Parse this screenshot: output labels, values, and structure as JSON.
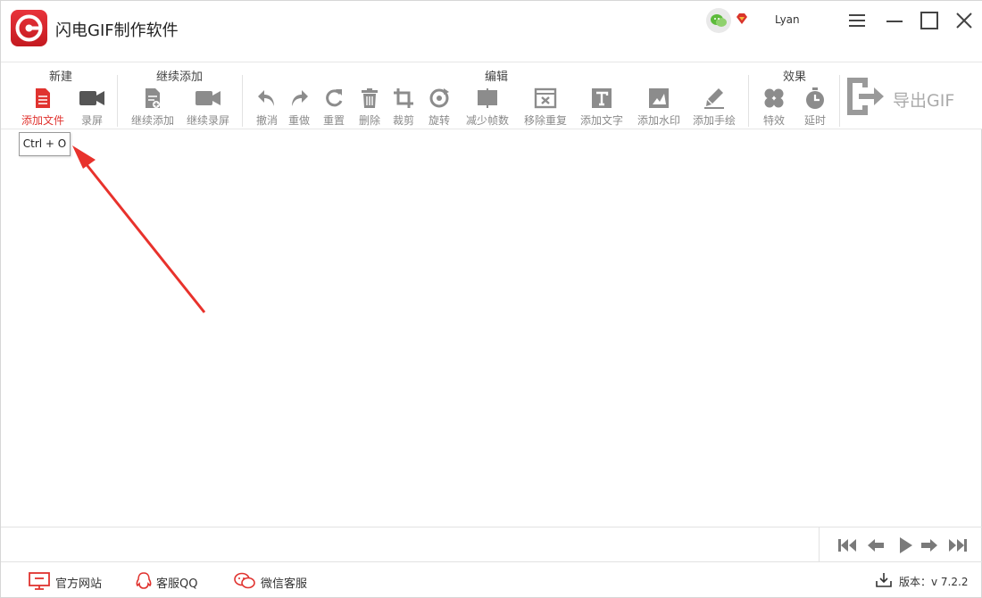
{
  "app": {
    "title": "闪电GIF制作软件"
  },
  "user": {
    "name": "Lyan"
  },
  "toolbar": {
    "groups": [
      {
        "title": "新建"
      },
      {
        "title": "继续添加"
      },
      {
        "title": "编辑"
      },
      {
        "title": "效果"
      }
    ],
    "tools": [
      {
        "label": "添加文件",
        "icon": "file-icon"
      },
      {
        "label": "录屏",
        "icon": "camera-icon"
      },
      {
        "label": "继续添加",
        "icon": "file-add-icon"
      },
      {
        "label": "继续录屏",
        "icon": "camera-icon"
      },
      {
        "label": "撤消",
        "icon": "undo-icon"
      },
      {
        "label": "重做",
        "icon": "redo-icon"
      },
      {
        "label": "重置",
        "icon": "reset-icon"
      },
      {
        "label": "删除",
        "icon": "trash-icon"
      },
      {
        "label": "裁剪",
        "icon": "crop-icon"
      },
      {
        "label": "旋转",
        "icon": "rotate-icon"
      },
      {
        "label": "减少帧数",
        "icon": "reduce-frames-icon"
      },
      {
        "label": "移除重复",
        "icon": "remove-duplicate-icon"
      },
      {
        "label": "添加文字",
        "icon": "text-icon"
      },
      {
        "label": "添加水印",
        "icon": "watermark-icon"
      },
      {
        "label": "添加手绘",
        "icon": "brush-icon"
      },
      {
        "label": "特效",
        "icon": "effects-icon"
      },
      {
        "label": "延时",
        "icon": "timer-icon"
      }
    ],
    "export_label": "导出GIF"
  },
  "tooltip": {
    "text": "Ctrl + O"
  },
  "footer": {
    "website": "官方网站",
    "qq": "客服QQ",
    "wechat": "微信客服",
    "version": "版本：v 7.2.2"
  },
  "colors": {
    "accent": "#e0332f",
    "icon_gray": "#8c8c8c"
  }
}
